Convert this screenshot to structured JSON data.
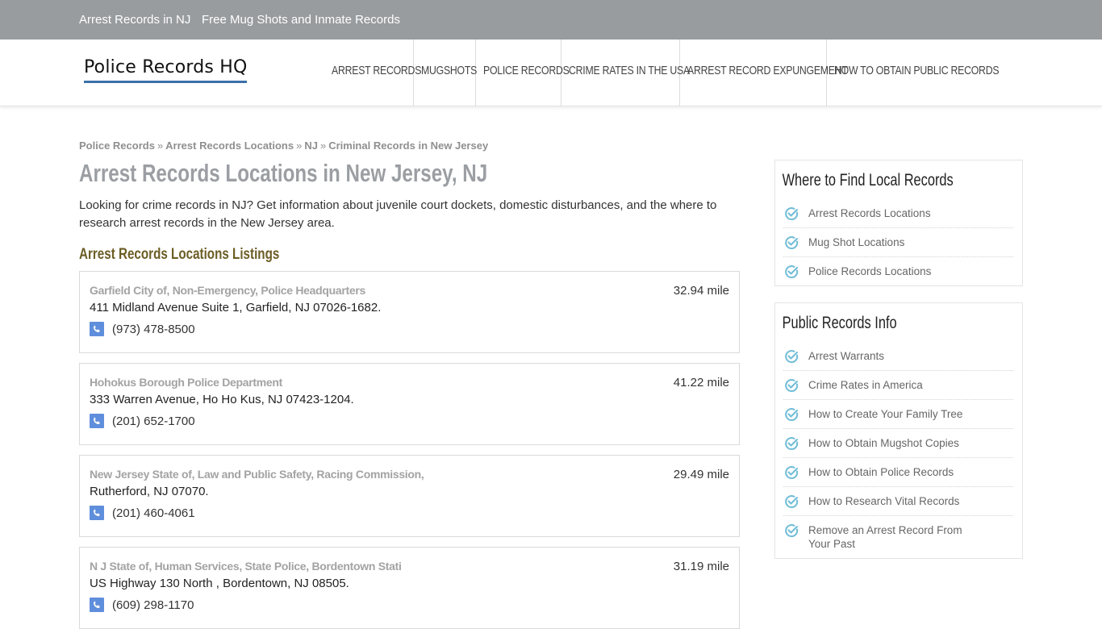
{
  "topbar": {
    "links": [
      "Arrest Records in NJ",
      "Free Mug Shots and Inmate Records"
    ]
  },
  "header": {
    "logo": "Police Records HQ",
    "nav": [
      "ARREST RECORDS",
      "MUGSHOTS",
      "POLICE RECORDS",
      "CRIME RATES IN THE USA",
      "ARREST RECORD EXPUNGEMENT",
      "HOW TO OBTAIN PUBLIC RECORDS"
    ]
  },
  "breadcrumb": {
    "items": [
      "Police Records",
      "Arrest Records Locations",
      "NJ",
      "Criminal Records in New Jersey"
    ],
    "separator": "»"
  },
  "main": {
    "title": "Arrest Records Locations in New Jersey, NJ",
    "intro": "Looking for crime records in NJ? Get information about juvenile court dockets, domestic disturbances, and the where to research arrest records in the New Jersey area.",
    "listings_title": "Arrest Records Locations Listings",
    "listings": [
      {
        "name": "Garfield City of, Non-Emergency, Police Headquarters",
        "address": "411 Midland Avenue Suite 1, Garfield, NJ 07026-1682.",
        "phone": "(973) 478-8500",
        "distance": "32.94 mile"
      },
      {
        "name": "Hohokus Borough Police Department",
        "address": "333 Warren Avenue, Ho Ho Kus, NJ 07423-1204.",
        "phone": "(201) 652-1700",
        "distance": "41.22 mile"
      },
      {
        "name": "New Jersey State of, Law and Public Safety, Racing Commission,",
        "address": "Rutherford, NJ 07070.",
        "phone": "(201) 460-4061",
        "distance": "29.49 mile"
      },
      {
        "name": "N J State of, Human Services, State Police, Bordentown Stati",
        "address": "US Highway 130 North , Bordentown, NJ 08505.",
        "phone": "(609) 298-1170",
        "distance": "31.19 mile"
      }
    ]
  },
  "sidebar": {
    "widgets": [
      {
        "title": "Where to Find Local Records",
        "items": [
          "Arrest Records Locations",
          "Mug Shot Locations",
          "Police Records Locations"
        ]
      },
      {
        "title": "Public Records Info",
        "items": [
          "Arrest Warrants",
          "Crime Rates in America",
          "How to Create Your Family Tree",
          "How to Obtain Mugshot Copies",
          "How to Obtain Police Records",
          "How to Research Vital Records",
          "Remove an Arrest Record From Your Past"
        ]
      }
    ]
  },
  "colors": {
    "topbar_bg": "#999c9f",
    "logo_underline": "#3d6fa8",
    "listings_title": "#6b5d24",
    "phone_icon_bg": "#5f8fdc",
    "check_icon": "#6fbcd6"
  }
}
